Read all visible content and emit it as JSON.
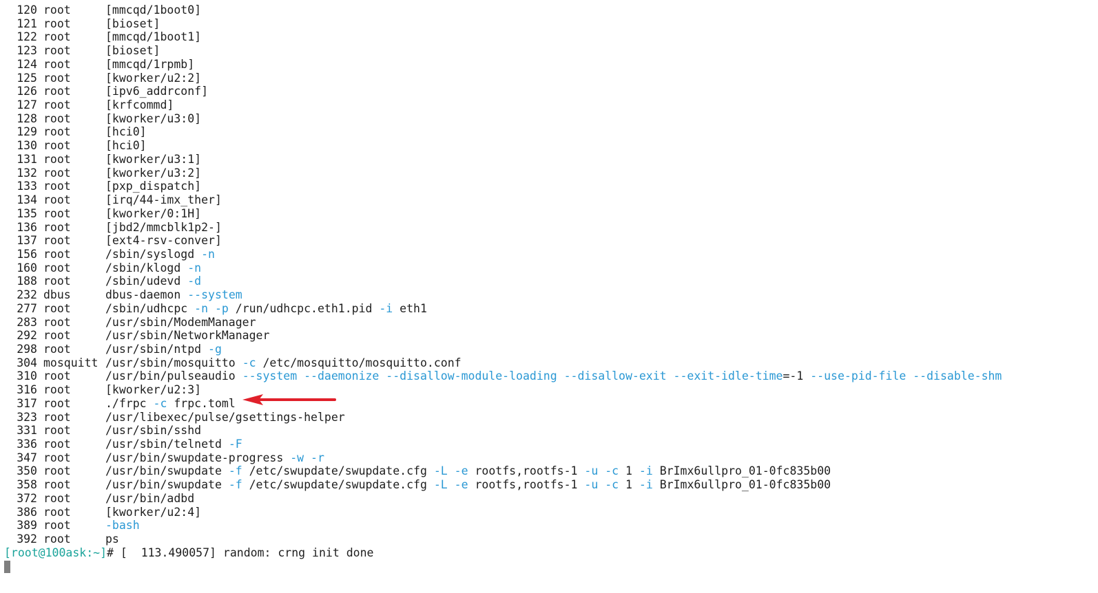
{
  "terminal": {
    "rows": [
      {
        "pid": "120",
        "user": "root",
        "cmd": [
          {
            "t": "[mmcqd/1boot0]"
          }
        ]
      },
      {
        "pid": "121",
        "user": "root",
        "cmd": [
          {
            "t": "[bioset]"
          }
        ]
      },
      {
        "pid": "122",
        "user": "root",
        "cmd": [
          {
            "t": "[mmcqd/1boot1]"
          }
        ]
      },
      {
        "pid": "123",
        "user": "root",
        "cmd": [
          {
            "t": "[bioset]"
          }
        ]
      },
      {
        "pid": "124",
        "user": "root",
        "cmd": [
          {
            "t": "[mmcqd/1rpmb]"
          }
        ]
      },
      {
        "pid": "125",
        "user": "root",
        "cmd": [
          {
            "t": "[kworker/u2:2]"
          }
        ]
      },
      {
        "pid": "126",
        "user": "root",
        "cmd": [
          {
            "t": "[ipv6_addrconf]"
          }
        ]
      },
      {
        "pid": "127",
        "user": "root",
        "cmd": [
          {
            "t": "[krfcommd]"
          }
        ]
      },
      {
        "pid": "128",
        "user": "root",
        "cmd": [
          {
            "t": "[kworker/u3:0]"
          }
        ]
      },
      {
        "pid": "129",
        "user": "root",
        "cmd": [
          {
            "t": "[hci0]"
          }
        ]
      },
      {
        "pid": "130",
        "user": "root",
        "cmd": [
          {
            "t": "[hci0]"
          }
        ]
      },
      {
        "pid": "131",
        "user": "root",
        "cmd": [
          {
            "t": "[kworker/u3:1]"
          }
        ]
      },
      {
        "pid": "132",
        "user": "root",
        "cmd": [
          {
            "t": "[kworker/u3:2]"
          }
        ]
      },
      {
        "pid": "133",
        "user": "root",
        "cmd": [
          {
            "t": "[pxp_dispatch]"
          }
        ]
      },
      {
        "pid": "134",
        "user": "root",
        "cmd": [
          {
            "t": "[irq/44-imx_ther]"
          }
        ]
      },
      {
        "pid": "135",
        "user": "root",
        "cmd": [
          {
            "t": "[kworker/0:1H]"
          }
        ]
      },
      {
        "pid": "136",
        "user": "root",
        "cmd": [
          {
            "t": "[jbd2/mmcblk1p2-]"
          }
        ]
      },
      {
        "pid": "137",
        "user": "root",
        "cmd": [
          {
            "t": "[ext4-rsv-conver]"
          }
        ]
      },
      {
        "pid": "156",
        "user": "root",
        "cmd": [
          {
            "t": "/sbin/syslogd "
          },
          {
            "t": "-n",
            "o": 1
          }
        ]
      },
      {
        "pid": "160",
        "user": "root",
        "cmd": [
          {
            "t": "/sbin/klogd "
          },
          {
            "t": "-n",
            "o": 1
          }
        ]
      },
      {
        "pid": "188",
        "user": "root",
        "cmd": [
          {
            "t": "/sbin/udevd "
          },
          {
            "t": "-d",
            "o": 1
          }
        ]
      },
      {
        "pid": "232",
        "user": "dbus",
        "cmd": [
          {
            "t": "dbus-daemon "
          },
          {
            "t": "--system",
            "o": 1
          }
        ]
      },
      {
        "pid": "277",
        "user": "root",
        "cmd": [
          {
            "t": "/sbin/udhcpc "
          },
          {
            "t": "-n",
            "o": 1
          },
          {
            "t": " "
          },
          {
            "t": "-p",
            "o": 1
          },
          {
            "t": " /run/udhcpc.eth1.pid "
          },
          {
            "t": "-i",
            "o": 1
          },
          {
            "t": " eth1"
          }
        ]
      },
      {
        "pid": "283",
        "user": "root",
        "cmd": [
          {
            "t": "/usr/sbin/ModemManager"
          }
        ]
      },
      {
        "pid": "292",
        "user": "root",
        "cmd": [
          {
            "t": "/usr/sbin/NetworkManager"
          }
        ]
      },
      {
        "pid": "298",
        "user": "root",
        "cmd": [
          {
            "t": "/usr/sbin/ntpd "
          },
          {
            "t": "-g",
            "o": 1
          }
        ]
      },
      {
        "pid": "304",
        "user": "mosquitt",
        "cmd": [
          {
            "t": "/usr/sbin/mosquitto "
          },
          {
            "t": "-c",
            "o": 1
          },
          {
            "t": " /etc/mosquitto/mosquitto.conf"
          }
        ]
      },
      {
        "pid": "310",
        "user": "root",
        "cmd": [
          {
            "t": "/usr/bin/pulseaudio "
          },
          {
            "t": "--system --daemonize --disallow-module-loading --disallow-exit --exit-idle-time",
            "o": 1
          },
          {
            "t": "=-1 "
          },
          {
            "t": "--use-pid-file --disable-shm",
            "o": 1
          }
        ]
      },
      {
        "pid": "316",
        "user": "root",
        "cmd": [
          {
            "t": "[kworker/u2:3]"
          }
        ]
      },
      {
        "pid": "317",
        "user": "root",
        "cmd": [
          {
            "t": "./frpc "
          },
          {
            "t": "-c",
            "o": 1
          },
          {
            "t": " frpc.toml"
          }
        ]
      },
      {
        "pid": "323",
        "user": "root",
        "cmd": [
          {
            "t": "/usr/libexec/pulse/gsettings-helper"
          }
        ]
      },
      {
        "pid": "331",
        "user": "root",
        "cmd": [
          {
            "t": "/usr/sbin/sshd"
          }
        ]
      },
      {
        "pid": "336",
        "user": "root",
        "cmd": [
          {
            "t": "/usr/sbin/telnetd "
          },
          {
            "t": "-F",
            "o": 1
          }
        ]
      },
      {
        "pid": "347",
        "user": "root",
        "cmd": [
          {
            "t": "/usr/bin/swupdate-progress "
          },
          {
            "t": "-w",
            "o": 1
          },
          {
            "t": " "
          },
          {
            "t": "-r",
            "o": 1
          }
        ]
      },
      {
        "pid": "350",
        "user": "root",
        "cmd": [
          {
            "t": "/usr/bin/swupdate "
          },
          {
            "t": "-f",
            "o": 1
          },
          {
            "t": " /etc/swupdate/swupdate.cfg "
          },
          {
            "t": "-L",
            "o": 1
          },
          {
            "t": " "
          },
          {
            "t": "-e",
            "o": 1
          },
          {
            "t": " rootfs,rootfs-1 "
          },
          {
            "t": "-u",
            "o": 1
          },
          {
            "t": " "
          },
          {
            "t": "-c",
            "o": 1
          },
          {
            "t": " 1 "
          },
          {
            "t": "-i",
            "o": 1
          },
          {
            "t": " BrImx6ullpro_01-0fc835b00"
          }
        ]
      },
      {
        "pid": "358",
        "user": "root",
        "cmd": [
          {
            "t": "/usr/bin/swupdate "
          },
          {
            "t": "-f",
            "o": 1
          },
          {
            "t": " /etc/swupdate/swupdate.cfg "
          },
          {
            "t": "-L",
            "o": 1
          },
          {
            "t": " "
          },
          {
            "t": "-e",
            "o": 1
          },
          {
            "t": " rootfs,rootfs-1 "
          },
          {
            "t": "-u",
            "o": 1
          },
          {
            "t": " "
          },
          {
            "t": "-c",
            "o": 1
          },
          {
            "t": " 1 "
          },
          {
            "t": "-i",
            "o": 1
          },
          {
            "t": " BrImx6ullpro_01-0fc835b00"
          }
        ]
      },
      {
        "pid": "372",
        "user": "root",
        "cmd": [
          {
            "t": "/usr/bin/adbd"
          }
        ]
      },
      {
        "pid": "386",
        "user": "root",
        "cmd": [
          {
            "t": "[kworker/u2:4]"
          }
        ]
      },
      {
        "pid": "389",
        "user": "root",
        "cmd": [
          {
            "t": "-bash",
            "o": 1
          }
        ]
      },
      {
        "pid": "392",
        "user": "root",
        "cmd": [
          {
            "t": "ps"
          }
        ]
      }
    ],
    "prompt": {
      "text": "[root@100ask:~]",
      "symbol": "# ",
      "message": "[  113.490057] random: crng init done"
    }
  },
  "annotation": {
    "arrow_color": "#e0202a",
    "arrow_icon": "left-arrow-icon",
    "target_pid": "317"
  },
  "colors": {
    "background": "#ffffff",
    "text": "#1e1e1e",
    "option": "#2a98d4",
    "prompt": "#1aa39a",
    "cursor": "#7f7f7f"
  }
}
